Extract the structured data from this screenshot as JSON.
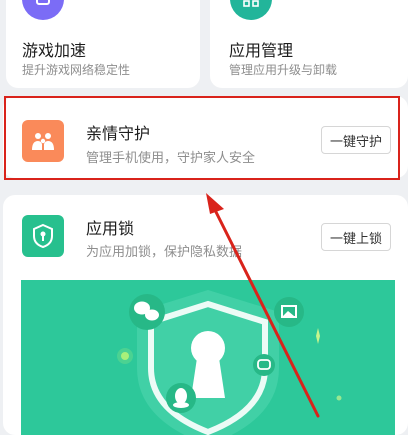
{
  "features": {
    "game_boost": {
      "title": "游戏加速",
      "subtitle": "提升游戏网络稳定性",
      "icon": "game-controller-icon"
    },
    "app_manage": {
      "title": "应用管理",
      "subtitle": "管理应用升级与卸载",
      "icon": "apps-grid-icon"
    },
    "family_guard": {
      "title": "亲情守护",
      "subtitle": "管理手机使用，守护家人安全",
      "button": "一键守护",
      "icon": "family-icon"
    },
    "app_lock": {
      "title": "应用锁",
      "subtitle": "为应用加锁，保护隐私数据",
      "button": "一键上锁",
      "icon": "shield-lock-icon"
    }
  },
  "colors": {
    "game_icon": "#7b6cf6",
    "app_manage_icon": "#22b59a",
    "family_icon": "#fa8a5a",
    "lock_icon": "#27c08e",
    "banner": "#2dc89a",
    "highlight": "#d9231b"
  },
  "banner": {
    "icons": [
      "wechat-icon",
      "keyhole-icon",
      "qq-icon",
      "gallery-icon",
      "chat-bubble-icon"
    ]
  }
}
